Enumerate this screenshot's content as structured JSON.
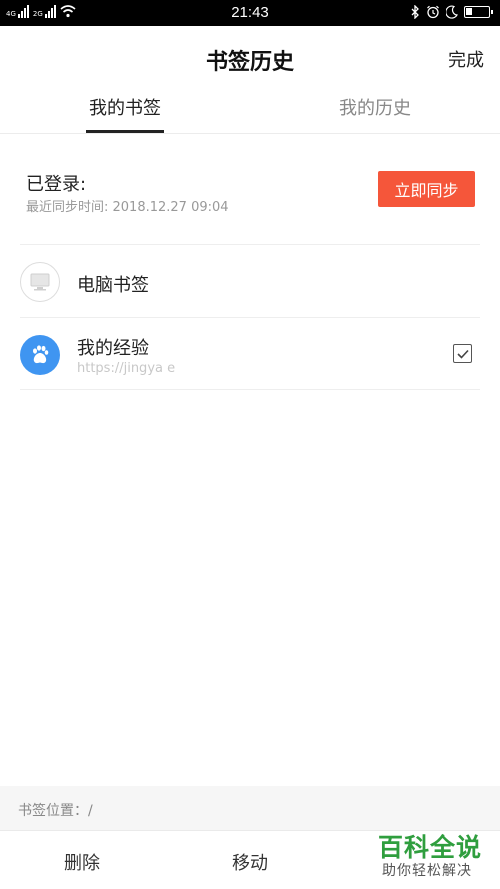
{
  "status_bar": {
    "time": "21:43",
    "sim1_label": "4G",
    "sim2_label": "2G",
    "battery_level": 0.3,
    "icons": [
      "bluetooth-icon",
      "alarm-icon",
      "moon-icon",
      "battery-icon"
    ]
  },
  "header": {
    "title": "书签历史",
    "done_label": "完成"
  },
  "tabs": [
    {
      "label": "我的书签",
      "active": true
    },
    {
      "label": "我的历史",
      "active": false
    }
  ],
  "account": {
    "login_label": "已登录:",
    "sync_time": "最近同步时间: 2018.12.27 09:04",
    "sync_button": "立即同步"
  },
  "bookmarks": [
    {
      "title": "电脑书签",
      "icon": "computer-icon"
    },
    {
      "title": "我的经验",
      "url": "https://jingya                                              e",
      "icon": "baidu-paw-icon",
      "checked": true
    }
  ],
  "location": {
    "text": "书签位置：/"
  },
  "bottom_bar": {
    "delete_label": "删除",
    "move_label": "移动"
  },
  "watermark": {
    "main": "百科全说",
    "sub": "助你轻松解决"
  },
  "colors": {
    "accent": "#f5563a",
    "baidu_blue": "#3f95f1",
    "watermark_green": "#2f9e3e"
  }
}
